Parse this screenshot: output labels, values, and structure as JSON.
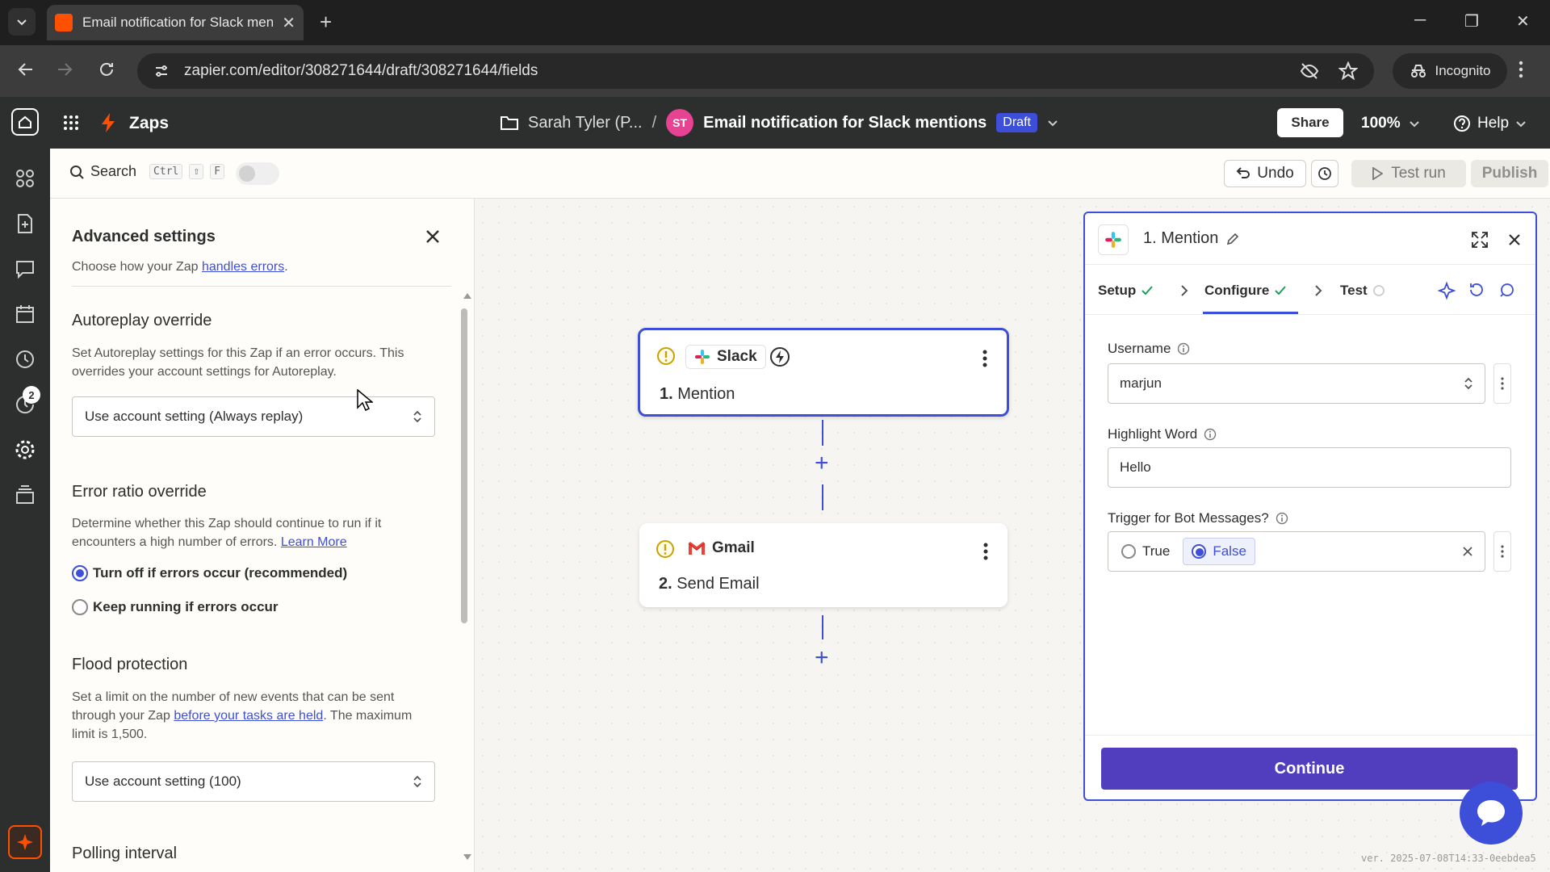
{
  "browser": {
    "tab_title": "Email notification for Slack mentions",
    "url": "zapier.com/editor/308271644/draft/308271644/fields",
    "incognito_label": "Incognito"
  },
  "header": {
    "app_label": "Zaps",
    "folder": "Sarah Tyler (P...",
    "separator": "/",
    "avatar_initials": "ST",
    "zap_name": "Email notification for Slack mentions",
    "status_badge": "Draft",
    "share_label": "Share",
    "zoom": "100%",
    "help_label": "Help"
  },
  "rail": {
    "notification_count": "2"
  },
  "toolbar": {
    "search_label": "Search",
    "shortcut_ctrl": "Ctrl",
    "shortcut_shift": "⇧",
    "shortcut_key": "F",
    "undo_label": "Undo",
    "test_run_label": "Test run",
    "publish_label": "Publish"
  },
  "advanced": {
    "title": "Advanced settings",
    "subtitle_prefix": "Choose how your Zap",
    "subtitle_link": "handles errors",
    "subtitle_suffix": ".",
    "autoreplay": {
      "heading": "Autoreplay override",
      "desc": "Set Autoreplay settings for this Zap if an error occurs. This overrides your account settings for Autoreplay.",
      "value": "Use account setting (Always replay)"
    },
    "error_ratio": {
      "heading": "Error ratio override",
      "desc": "Determine whether this Zap should continue to run if it encounters a high number of errors.",
      "link": "Learn More",
      "options": [
        "Turn off if errors occur (recommended)",
        "Keep running if errors occur"
      ],
      "selected": 0
    },
    "flood": {
      "heading": "Flood protection",
      "desc_prefix": "Set a limit on the number of new events that can be sent through your Zap",
      "desc_link": "before your tasks are held",
      "desc_suffix": ". The maximum limit is 1,500.",
      "value": "Use account setting (100)"
    },
    "polling": {
      "heading": "Polling interval"
    }
  },
  "canvas": {
    "nodes": [
      {
        "app": "Slack",
        "step": "1.",
        "title": "Mention"
      },
      {
        "app": "Gmail",
        "step": "2.",
        "title": "Send Email"
      }
    ]
  },
  "panel": {
    "title": "1. Mention",
    "steps": [
      "Setup",
      "Configure",
      "Test"
    ],
    "fields": {
      "username_label": "Username",
      "username_value": "marjun",
      "highlight_label": "Highlight Word",
      "highlight_value": "Hello",
      "bot_label": "Trigger for Bot Messages?",
      "bot_true": "True",
      "bot_false": "False"
    },
    "continue_label": "Continue"
  },
  "version_text": "ver. 2025-07-08T14:33-0eebdea5",
  "colors": {
    "accent": "#3d4fd9",
    "brand_orange": "#ff4f00",
    "continue": "#503ebf",
    "header_bg": "#2d2e2e"
  }
}
